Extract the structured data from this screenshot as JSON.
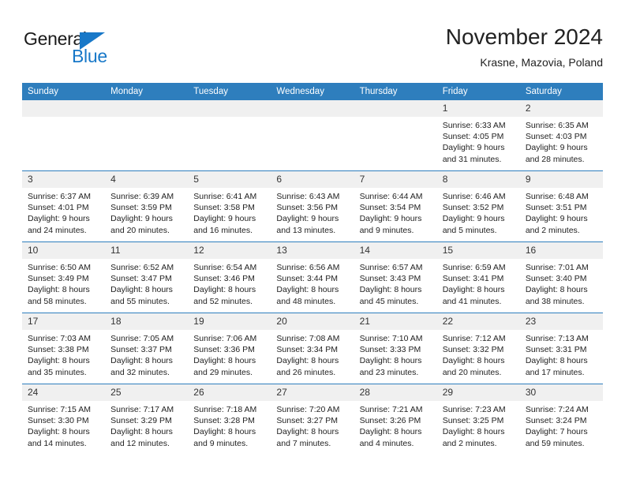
{
  "brand": {
    "name_part1": "General",
    "name_part2": "Blue"
  },
  "header": {
    "month_title": "November 2024",
    "location": "Krasne, Mazovia, Poland"
  },
  "calendar": {
    "weekday_headers": [
      "Sunday",
      "Monday",
      "Tuesday",
      "Wednesday",
      "Thursday",
      "Friday",
      "Saturday"
    ],
    "accent_color": "#2e7ebd",
    "day_header_bg": "#f0f0f0",
    "weeks": [
      [
        {
          "day": "",
          "blank": true
        },
        {
          "day": "",
          "blank": true
        },
        {
          "day": "",
          "blank": true
        },
        {
          "day": "",
          "blank": true
        },
        {
          "day": "",
          "blank": true
        },
        {
          "day": "1",
          "sunrise": "Sunrise: 6:33 AM",
          "sunset": "Sunset: 4:05 PM",
          "daylight_line1": "Daylight: 9 hours",
          "daylight_line2": "and 31 minutes."
        },
        {
          "day": "2",
          "sunrise": "Sunrise: 6:35 AM",
          "sunset": "Sunset: 4:03 PM",
          "daylight_line1": "Daylight: 9 hours",
          "daylight_line2": "and 28 minutes."
        }
      ],
      [
        {
          "day": "3",
          "sunrise": "Sunrise: 6:37 AM",
          "sunset": "Sunset: 4:01 PM",
          "daylight_line1": "Daylight: 9 hours",
          "daylight_line2": "and 24 minutes."
        },
        {
          "day": "4",
          "sunrise": "Sunrise: 6:39 AM",
          "sunset": "Sunset: 3:59 PM",
          "daylight_line1": "Daylight: 9 hours",
          "daylight_line2": "and 20 minutes."
        },
        {
          "day": "5",
          "sunrise": "Sunrise: 6:41 AM",
          "sunset": "Sunset: 3:58 PM",
          "daylight_line1": "Daylight: 9 hours",
          "daylight_line2": "and 16 minutes."
        },
        {
          "day": "6",
          "sunrise": "Sunrise: 6:43 AM",
          "sunset": "Sunset: 3:56 PM",
          "daylight_line1": "Daylight: 9 hours",
          "daylight_line2": "and 13 minutes."
        },
        {
          "day": "7",
          "sunrise": "Sunrise: 6:44 AM",
          "sunset": "Sunset: 3:54 PM",
          "daylight_line1": "Daylight: 9 hours",
          "daylight_line2": "and 9 minutes."
        },
        {
          "day": "8",
          "sunrise": "Sunrise: 6:46 AM",
          "sunset": "Sunset: 3:52 PM",
          "daylight_line1": "Daylight: 9 hours",
          "daylight_line2": "and 5 minutes."
        },
        {
          "day": "9",
          "sunrise": "Sunrise: 6:48 AM",
          "sunset": "Sunset: 3:51 PM",
          "daylight_line1": "Daylight: 9 hours",
          "daylight_line2": "and 2 minutes."
        }
      ],
      [
        {
          "day": "10",
          "sunrise": "Sunrise: 6:50 AM",
          "sunset": "Sunset: 3:49 PM",
          "daylight_line1": "Daylight: 8 hours",
          "daylight_line2": "and 58 minutes."
        },
        {
          "day": "11",
          "sunrise": "Sunrise: 6:52 AM",
          "sunset": "Sunset: 3:47 PM",
          "daylight_line1": "Daylight: 8 hours",
          "daylight_line2": "and 55 minutes."
        },
        {
          "day": "12",
          "sunrise": "Sunrise: 6:54 AM",
          "sunset": "Sunset: 3:46 PM",
          "daylight_line1": "Daylight: 8 hours",
          "daylight_line2": "and 52 minutes."
        },
        {
          "day": "13",
          "sunrise": "Sunrise: 6:56 AM",
          "sunset": "Sunset: 3:44 PM",
          "daylight_line1": "Daylight: 8 hours",
          "daylight_line2": "and 48 minutes."
        },
        {
          "day": "14",
          "sunrise": "Sunrise: 6:57 AM",
          "sunset": "Sunset: 3:43 PM",
          "daylight_line1": "Daylight: 8 hours",
          "daylight_line2": "and 45 minutes."
        },
        {
          "day": "15",
          "sunrise": "Sunrise: 6:59 AM",
          "sunset": "Sunset: 3:41 PM",
          "daylight_line1": "Daylight: 8 hours",
          "daylight_line2": "and 41 minutes."
        },
        {
          "day": "16",
          "sunrise": "Sunrise: 7:01 AM",
          "sunset": "Sunset: 3:40 PM",
          "daylight_line1": "Daylight: 8 hours",
          "daylight_line2": "and 38 minutes."
        }
      ],
      [
        {
          "day": "17",
          "sunrise": "Sunrise: 7:03 AM",
          "sunset": "Sunset: 3:38 PM",
          "daylight_line1": "Daylight: 8 hours",
          "daylight_line2": "and 35 minutes."
        },
        {
          "day": "18",
          "sunrise": "Sunrise: 7:05 AM",
          "sunset": "Sunset: 3:37 PM",
          "daylight_line1": "Daylight: 8 hours",
          "daylight_line2": "and 32 minutes."
        },
        {
          "day": "19",
          "sunrise": "Sunrise: 7:06 AM",
          "sunset": "Sunset: 3:36 PM",
          "daylight_line1": "Daylight: 8 hours",
          "daylight_line2": "and 29 minutes."
        },
        {
          "day": "20",
          "sunrise": "Sunrise: 7:08 AM",
          "sunset": "Sunset: 3:34 PM",
          "daylight_line1": "Daylight: 8 hours",
          "daylight_line2": "and 26 minutes."
        },
        {
          "day": "21",
          "sunrise": "Sunrise: 7:10 AM",
          "sunset": "Sunset: 3:33 PM",
          "daylight_line1": "Daylight: 8 hours",
          "daylight_line2": "and 23 minutes."
        },
        {
          "day": "22",
          "sunrise": "Sunrise: 7:12 AM",
          "sunset": "Sunset: 3:32 PM",
          "daylight_line1": "Daylight: 8 hours",
          "daylight_line2": "and 20 minutes."
        },
        {
          "day": "23",
          "sunrise": "Sunrise: 7:13 AM",
          "sunset": "Sunset: 3:31 PM",
          "daylight_line1": "Daylight: 8 hours",
          "daylight_line2": "and 17 minutes."
        }
      ],
      [
        {
          "day": "24",
          "sunrise": "Sunrise: 7:15 AM",
          "sunset": "Sunset: 3:30 PM",
          "daylight_line1": "Daylight: 8 hours",
          "daylight_line2": "and 14 minutes."
        },
        {
          "day": "25",
          "sunrise": "Sunrise: 7:17 AM",
          "sunset": "Sunset: 3:29 PM",
          "daylight_line1": "Daylight: 8 hours",
          "daylight_line2": "and 12 minutes."
        },
        {
          "day": "26",
          "sunrise": "Sunrise: 7:18 AM",
          "sunset": "Sunset: 3:28 PM",
          "daylight_line1": "Daylight: 8 hours",
          "daylight_line2": "and 9 minutes."
        },
        {
          "day": "27",
          "sunrise": "Sunrise: 7:20 AM",
          "sunset": "Sunset: 3:27 PM",
          "daylight_line1": "Daylight: 8 hours",
          "daylight_line2": "and 7 minutes."
        },
        {
          "day": "28",
          "sunrise": "Sunrise: 7:21 AM",
          "sunset": "Sunset: 3:26 PM",
          "daylight_line1": "Daylight: 8 hours",
          "daylight_line2": "and 4 minutes."
        },
        {
          "day": "29",
          "sunrise": "Sunrise: 7:23 AM",
          "sunset": "Sunset: 3:25 PM",
          "daylight_line1": "Daylight: 8 hours",
          "daylight_line2": "and 2 minutes."
        },
        {
          "day": "30",
          "sunrise": "Sunrise: 7:24 AM",
          "sunset": "Sunset: 3:24 PM",
          "daylight_line1": "Daylight: 7 hours",
          "daylight_line2": "and 59 minutes."
        }
      ]
    ]
  }
}
